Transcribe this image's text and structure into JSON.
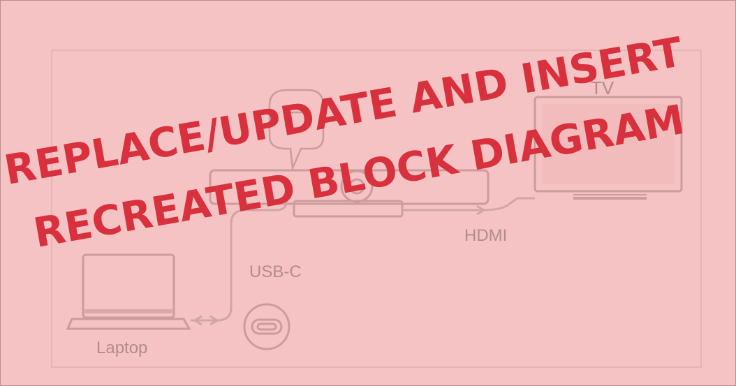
{
  "labels": {
    "tv": "TV",
    "hdmi": "HDMI",
    "usbc": "USB-C",
    "laptop": "Laptop"
  },
  "overlay": {
    "line1": "REPLACE/UPDATE AND INSERT",
    "line2": "RECREATED BLOCK DIAGRAM",
    "color": "#d8303c"
  },
  "colors": {
    "background": "#f5c3c4",
    "line": "#d2a5a5",
    "label": "#b48b8b"
  },
  "icons": [
    "laptop-icon",
    "tv-icon",
    "video-bar-icon",
    "usb-c-port-icon",
    "usb-c-plug-icon"
  ]
}
